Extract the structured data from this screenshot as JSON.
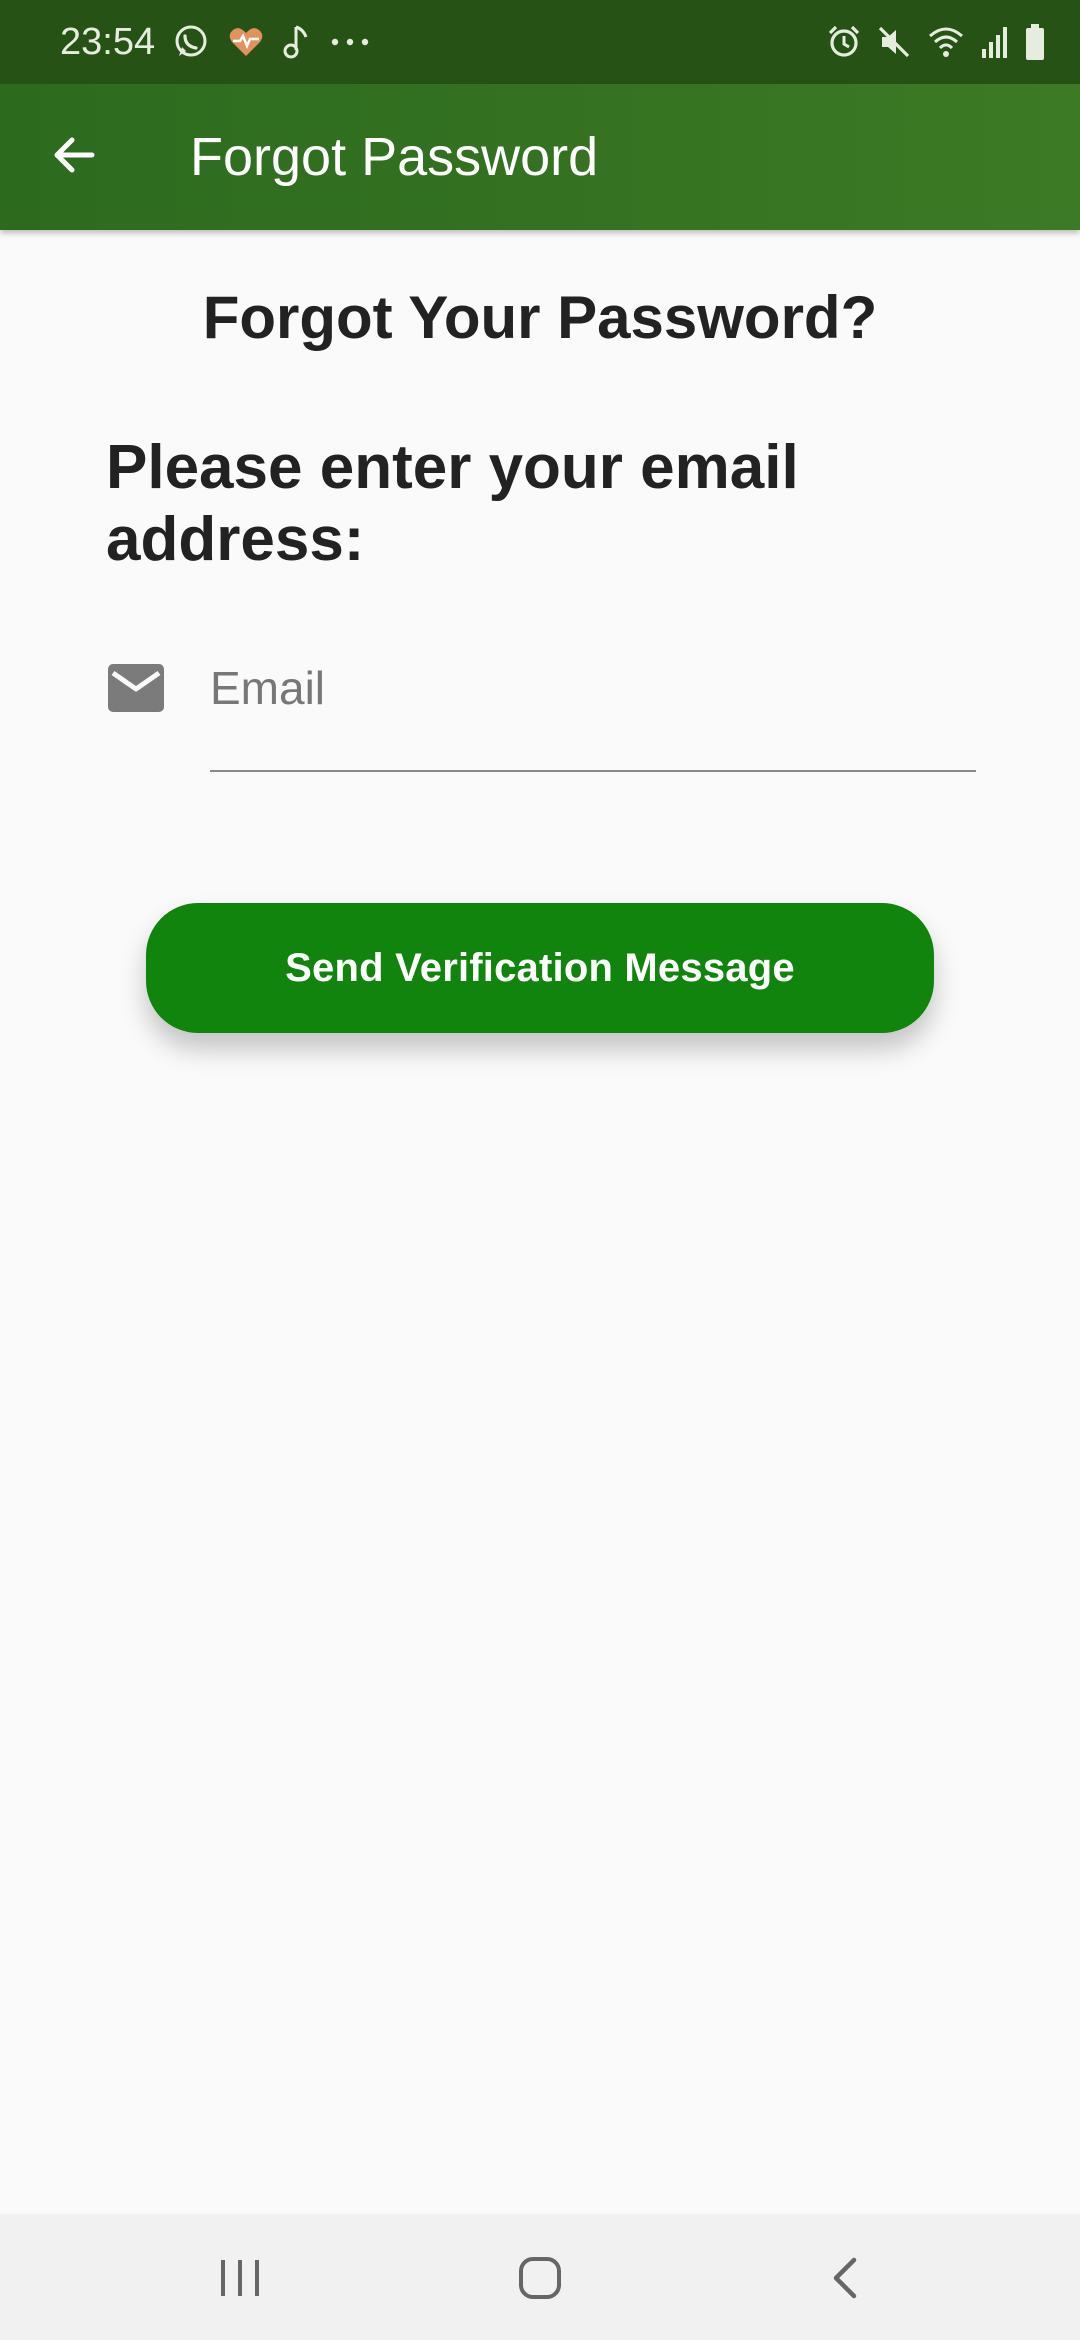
{
  "status_bar": {
    "time": "23:54",
    "left_icons": [
      "whatsapp-icon",
      "health-heart-icon",
      "music-note-icon",
      "more-dots-icon"
    ],
    "right_icons": [
      "alarm-icon",
      "mute-icon",
      "wifi-icon",
      "signal-icon",
      "battery-icon"
    ]
  },
  "app_bar": {
    "title": "Forgot Password",
    "back_icon": "arrow-back-icon",
    "color": "#2c6a1e"
  },
  "main": {
    "heading": "Forgot Your Password?",
    "prompt": "Please enter your email address:",
    "email_field": {
      "icon": "mail-icon",
      "placeholder": "Email",
      "value": ""
    },
    "send_button_label": "Send Verification Message",
    "button_color": "#11840d"
  },
  "nav_bar": {
    "items": [
      "recents-icon",
      "home-icon",
      "back-icon"
    ]
  }
}
